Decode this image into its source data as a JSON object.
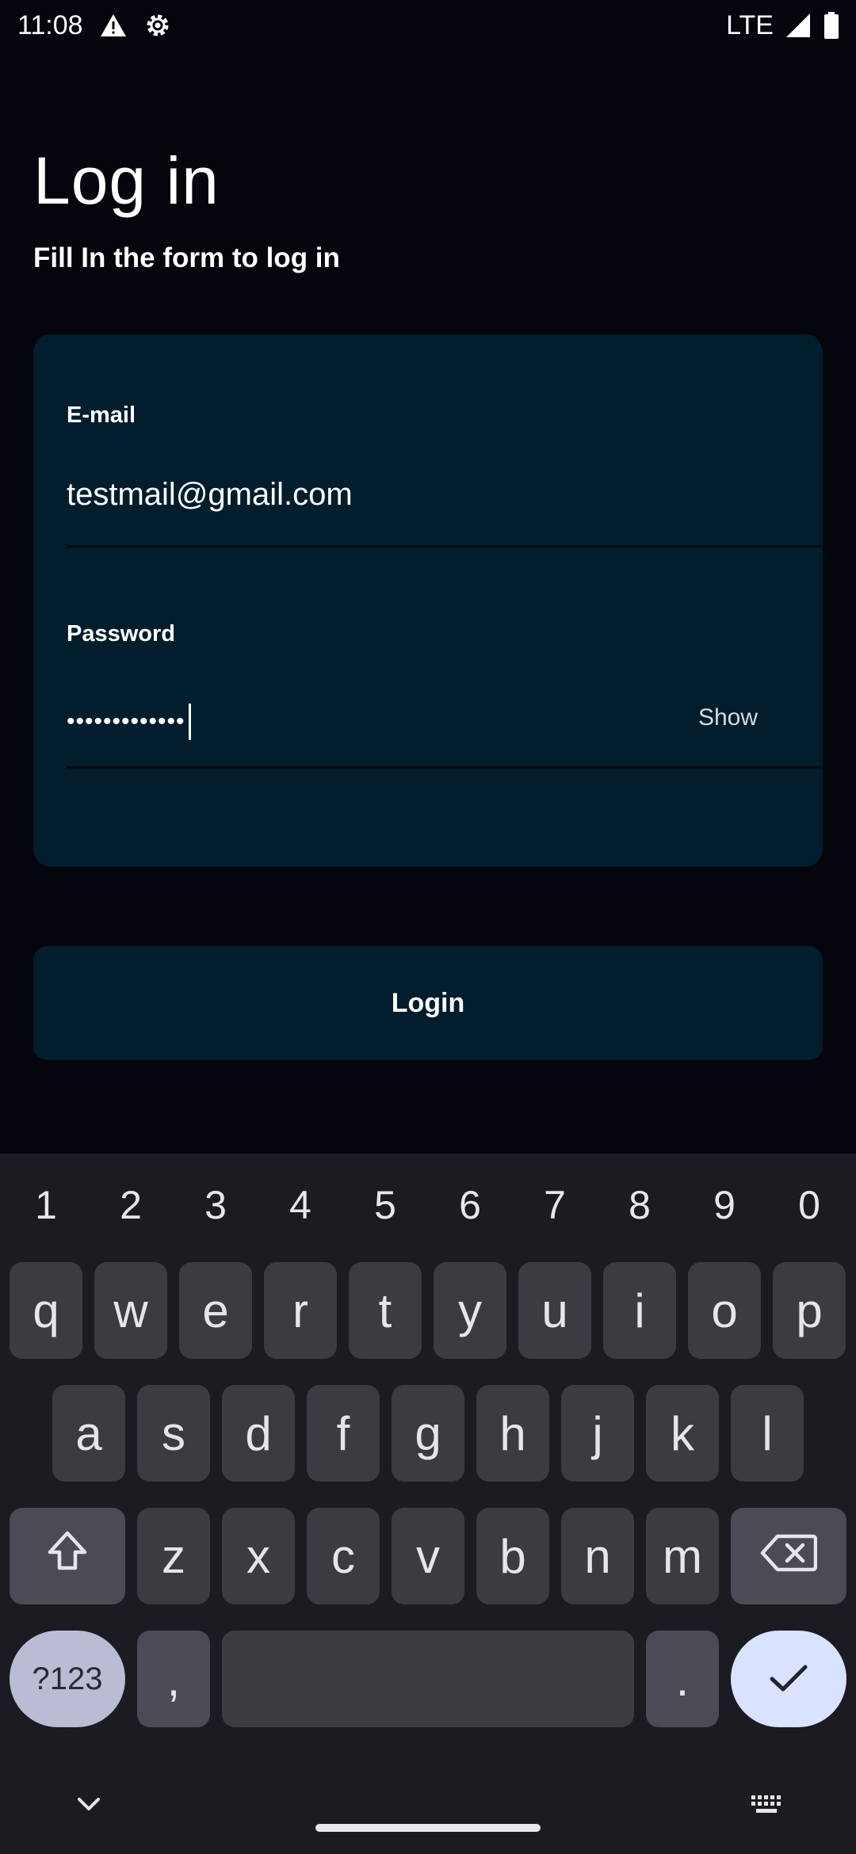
{
  "status_bar": {
    "time": "11:08",
    "network": "LTE"
  },
  "header": {
    "title": "Log in",
    "subtitle": "Fill In the form to log in"
  },
  "form": {
    "email": {
      "label": "E-mail",
      "value": "testmail@gmail.com"
    },
    "password": {
      "label": "Password",
      "masked_value": "•••••••••••••",
      "toggle_label": "Show"
    }
  },
  "login_button": {
    "label": "Login"
  },
  "keyboard": {
    "numbers": [
      "1",
      "2",
      "3",
      "4",
      "5",
      "6",
      "7",
      "8",
      "9",
      "0"
    ],
    "row1": [
      "q",
      "w",
      "e",
      "r",
      "t",
      "y",
      "u",
      "i",
      "o",
      "p"
    ],
    "row2": [
      "a",
      "s",
      "d",
      "f",
      "g",
      "h",
      "j",
      "k",
      "l"
    ],
    "row3": [
      "z",
      "x",
      "c",
      "v",
      "b",
      "n",
      "m"
    ],
    "symbols_label": "?123",
    "comma": ",",
    "period": "."
  },
  "icons": {
    "warning": "warning-icon",
    "settings": "gear-icon",
    "signal": "signal-icon",
    "battery": "battery-icon",
    "shift": "shift-icon",
    "backspace": "backspace-icon",
    "enter": "checkmark-icon",
    "hide_keyboard": "chevron-down-icon",
    "keyboard_switch": "keyboard-icon"
  },
  "colors": {
    "background": "#04050d",
    "card": "#021d2c",
    "keyboard": "#1b1b21",
    "key": "#3b3b42",
    "enter_key": "#d9e2ff"
  }
}
